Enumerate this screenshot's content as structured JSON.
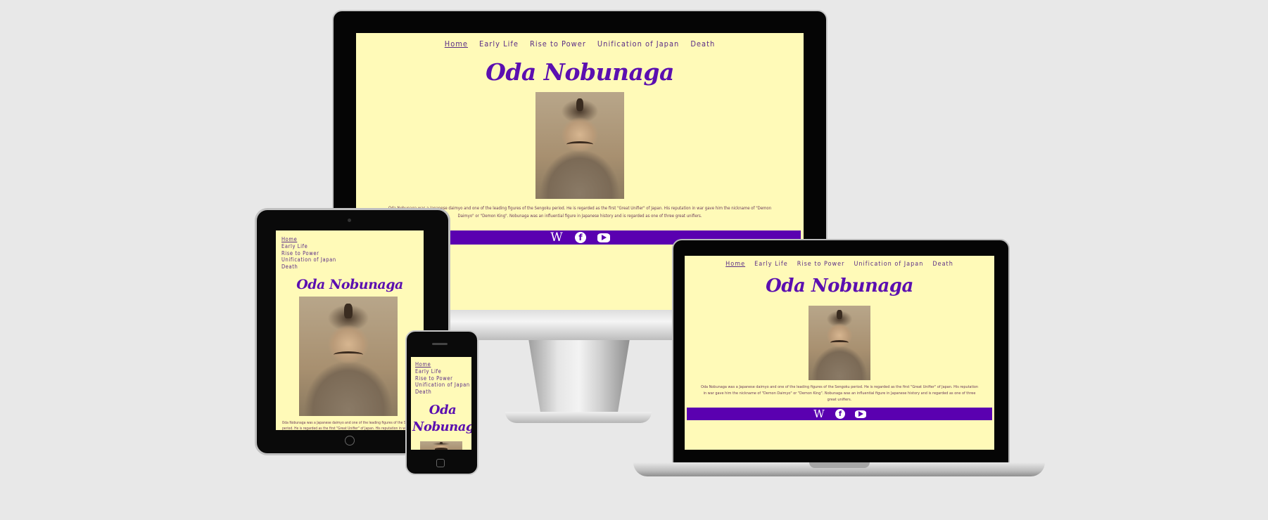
{
  "site": {
    "title": "Oda Nobunaga",
    "nav": [
      "Home",
      "Early Life",
      "Rise to Power",
      "Unification of Japan",
      "Death"
    ],
    "bio": "Oda Nobunaga was a Japanese daimyo and one of the leading figures of the Sengoku period. He is regarded as the first \"Great Unifier\" of Japan. His reputation in war gave him the nickname of \"Demon Daimyo\" or \"Demon King\". Nobunaga was an influential figure in Japanese history and is regarded as one of three great unifiers.",
    "bio_tablet": "Oda Nobunaga was a Japanese daimyo and one of the leading figures of the Sengoku period. He is regarded as the first \"Great Unifier\" of Japan. His reputation in war gave him the nickname",
    "social": [
      {
        "icon": "wikipedia-icon",
        "glyph": "W"
      },
      {
        "icon": "facebook-icon",
        "glyph": "f"
      },
      {
        "icon": "youtube-icon",
        "glyph": ""
      }
    ]
  },
  "colors": {
    "page_background": "#fffab8",
    "accent": "#5a00b0",
    "title": "#5b0fb0",
    "nav_text": "#5a2d86",
    "body_text": "#6b3a5a"
  }
}
